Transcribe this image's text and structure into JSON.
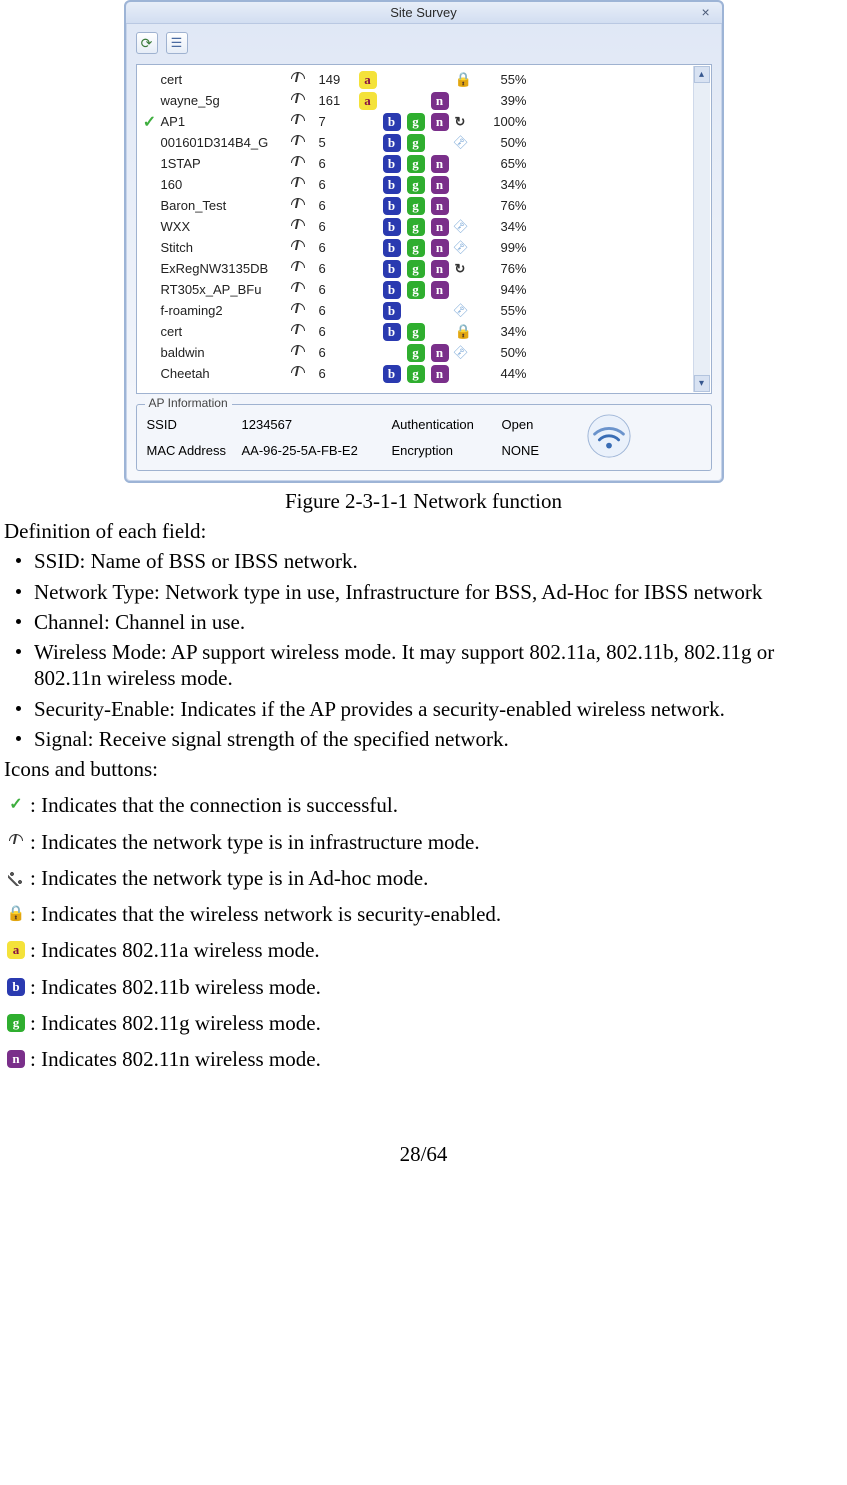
{
  "window": {
    "title": "Site Survey",
    "rows": [
      {
        "conn": false,
        "ssid": "cert",
        "ch": "149",
        "a": true,
        "b": false,
        "g": false,
        "n": false,
        "sec": "lock",
        "sig": "55%"
      },
      {
        "conn": false,
        "ssid": "wayne_5g",
        "ch": "161",
        "a": true,
        "b": false,
        "g": false,
        "n": true,
        "sec": "",
        "sig": "39%"
      },
      {
        "conn": true,
        "ssid": "AP1",
        "ch": "7",
        "a": false,
        "b": true,
        "g": true,
        "n": true,
        "sec": "ref",
        "sig": "100%"
      },
      {
        "conn": false,
        "ssid": "001601D314B4_G",
        "ch": "5",
        "a": false,
        "b": true,
        "g": true,
        "n": false,
        "sec": "key",
        "sig": "50%"
      },
      {
        "conn": false,
        "ssid": "1STAP",
        "ch": "6",
        "a": false,
        "b": true,
        "g": true,
        "n": true,
        "sec": "",
        "sig": "65%"
      },
      {
        "conn": false,
        "ssid": "160",
        "ch": "6",
        "a": false,
        "b": true,
        "g": true,
        "n": true,
        "sec": "",
        "sig": "34%"
      },
      {
        "conn": false,
        "ssid": "Baron_Test",
        "ch": "6",
        "a": false,
        "b": true,
        "g": true,
        "n": true,
        "sec": "",
        "sig": "76%"
      },
      {
        "conn": false,
        "ssid": "WXX",
        "ch": "6",
        "a": false,
        "b": true,
        "g": true,
        "n": true,
        "sec": "key",
        "sig": "34%"
      },
      {
        "conn": false,
        "ssid": "Stitch",
        "ch": "6",
        "a": false,
        "b": true,
        "g": true,
        "n": true,
        "sec": "key",
        "sig": "99%"
      },
      {
        "conn": false,
        "ssid": "ExRegNW3135DB",
        "ch": "6",
        "a": false,
        "b": true,
        "g": true,
        "n": true,
        "sec": "ref",
        "sig": "76%"
      },
      {
        "conn": false,
        "ssid": "RT305x_AP_BFu",
        "ch": "6",
        "a": false,
        "b": true,
        "g": true,
        "n": true,
        "sec": "",
        "sig": "94%"
      },
      {
        "conn": false,
        "ssid": "f-roaming2",
        "ch": "6",
        "a": false,
        "b": true,
        "g": false,
        "n": false,
        "sec": "key",
        "sig": "55%"
      },
      {
        "conn": false,
        "ssid": "cert",
        "ch": "6",
        "a": false,
        "b": true,
        "g": true,
        "n": false,
        "sec": "lock",
        "sig": "34%"
      },
      {
        "conn": false,
        "ssid": "baldwin",
        "ch": "6",
        "a": false,
        "b": false,
        "g": true,
        "n": true,
        "sec": "key",
        "sig": "50%"
      },
      {
        "conn": false,
        "ssid": "Cheetah",
        "ch": "6",
        "a": false,
        "b": true,
        "g": true,
        "n": true,
        "sec": "",
        "sig": "44%"
      }
    ],
    "apinfo": {
      "legend": "AP Information",
      "ssid_label": "SSID",
      "ssid": "1234567",
      "auth_label": "Authentication",
      "auth": "Open",
      "mac_label": "MAC Address",
      "mac": "AA-96-25-5A-FB-E2",
      "enc_label": "Encryption",
      "enc": "NONE"
    }
  },
  "caption": "Figure 2-3-1-1 Network function",
  "body": {
    "defs_heading": "Definition of each field:",
    "defs": [
      "SSID: Name of BSS or IBSS network.",
      "Network Type: Network type in use, Infrastructure for BSS, Ad-Hoc for IBSS network",
      "Channel: Channel in use.",
      "Wireless Mode: AP support wireless mode. It may support 802.11a, 802.11b, 802.11g or 802.11n wireless mode.",
      "Security-Enable: Indicates if the AP provides a security-enabled wireless network.",
      "Signal: Receive signal strength of the specified network."
    ],
    "icons_heading": "Icons and buttons:",
    "icon_descs": {
      "check": ": Indicates that the connection is successful.",
      "infra": ": Indicates the network type is in infrastructure mode.",
      "adhoc": " : Indicates the network type is in Ad-hoc mode.",
      "sec": " : Indicates that the wireless network is security-enabled.",
      "a": " : Indicates 802.11a wireless mode.",
      "b": " : Indicates 802.11b wireless mode.",
      "g": ": Indicates 802.11g wireless mode.",
      "n": ": Indicates 802.11n wireless mode."
    }
  },
  "page_number": "28/64"
}
